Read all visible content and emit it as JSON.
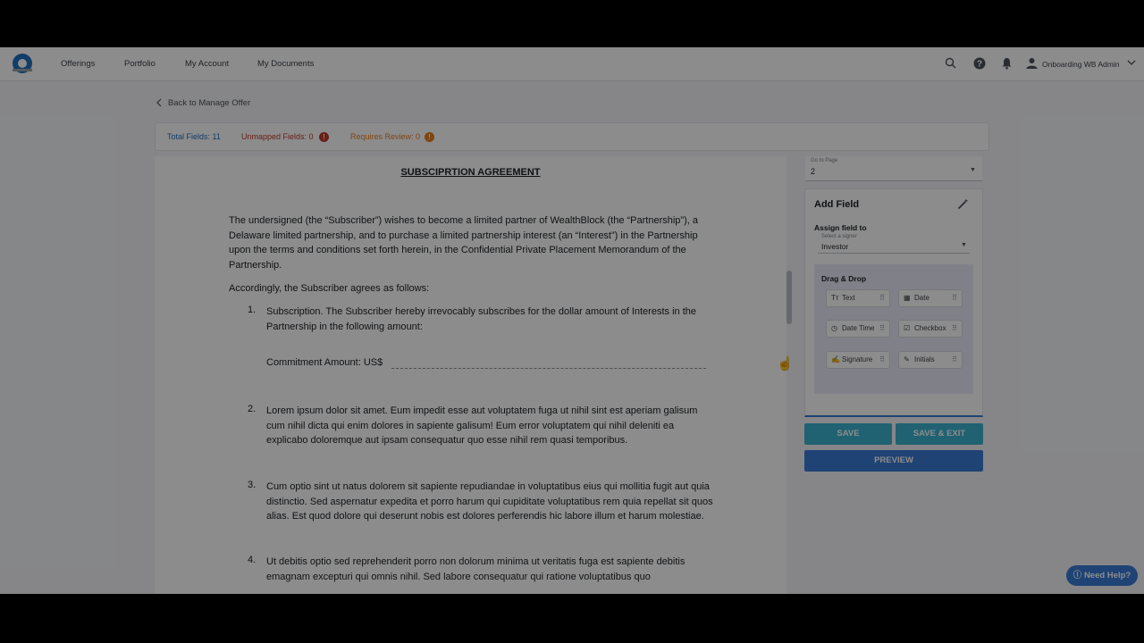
{
  "nav": {
    "items": [
      {
        "label": "Offerings"
      },
      {
        "label": "Portfolio"
      },
      {
        "label": "My Account"
      },
      {
        "label": "My Documents"
      }
    ],
    "user_name": "Onboarding WB Admin"
  },
  "back_link": "Back to Manage Offer",
  "stats": {
    "total": "Total Fields: 11",
    "unmapped": "Unmapped Fields: 0",
    "review": "Requires Review: 0"
  },
  "document": {
    "title": "SUBSCIPRTION AGREEMENT",
    "para1": "The undersigned (the “Subscriber”) wishes to become a limited partner of WealthBlock (the “Partnership”), a Delaware limited partnership, and to purchase a limited partnership interest (an “Interest”) in the Partnership upon the terms and conditions set forth herein, in the Confidential Private Placement Memorandum of the Partnership.",
    "para2": "Accordingly, the Subscriber agrees as follows:",
    "items": [
      {
        "num": "1.",
        "text": "Subscription. The Subscriber hereby irrevocably subscribes for the dollar amount of Interests in the Partnership in the following amount:"
      },
      {
        "num": "2.",
        "text": "Lorem ipsum dolor sit amet. Eum impedit esse aut voluptatem fuga ut nihil sint est aperiam galisum cum nihil dicta qui enim dolores in sapiente galisum! Eum error voluptatem qui nihil deleniti ea explicabo doloremque aut ipsam consequatur quo esse nihil rem quasi temporibus."
      },
      {
        "num": "3.",
        "text": "Cum optio sint ut natus dolorem sit sapiente repudiandae in voluptatibus eius qui mollitia fugit aut quia distinctio. Sed aspernatur expedita et porro harum qui cupiditate voluptatibus rem quia repellat sit quos alias. Est quod dolore qui deserunt nobis est dolores perferendis hic labore illum et harum molestiae."
      },
      {
        "num": "4.",
        "text": "Ut debitis optio sed reprehenderit porro non dolorum minima ut veritatis fuga est sapiente debitis emagnam excepturi qui omnis nihil. Sed labore consequatur qui ratione voluptatibus quo"
      }
    ],
    "commitment_label": "Commitment Amount: US$"
  },
  "goto_page": {
    "label": "Go to Page",
    "value": "2"
  },
  "add_field": {
    "title": "Add Field",
    "assign_label": "Assign field to",
    "signer_label": "Select a signer",
    "signer_value": "Investor",
    "dd_title": "Drag & Drop",
    "chips": [
      {
        "icon": "text-icon",
        "label": "Text"
      },
      {
        "icon": "calendar-icon",
        "label": "Date"
      },
      {
        "icon": "clock-icon",
        "label": "Date Time"
      },
      {
        "icon": "checkbox-icon",
        "label": "Checkbox"
      },
      {
        "icon": "signature-icon",
        "label": "Signature"
      },
      {
        "icon": "pen-icon",
        "label": "Initials"
      }
    ]
  },
  "buttons": {
    "save": "SAVE",
    "save_exit": "SAVE & EXIT",
    "preview": "PREVIEW"
  },
  "help": "Need Help?",
  "colors": {
    "primary": "#3a7bd5",
    "teal": "#3bb3d0",
    "stat_total": "#1f6fbf",
    "stat_unmapped": "#c0392b",
    "stat_review": "#e67e22"
  }
}
